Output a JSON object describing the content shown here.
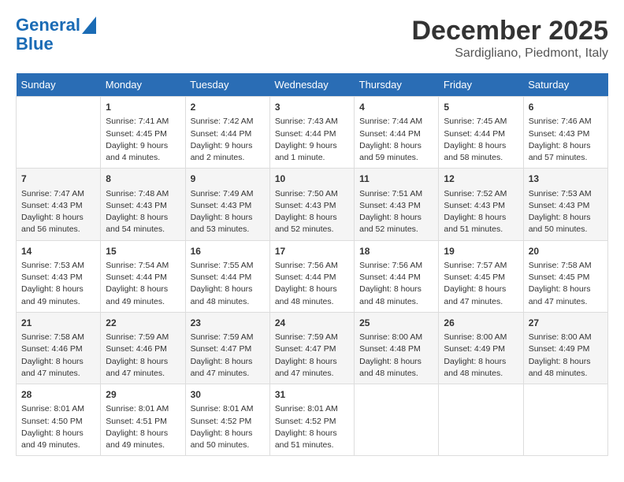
{
  "logo": {
    "line1": "General",
    "line2": "Blue"
  },
  "title": "December 2025",
  "location": "Sardigliano, Piedmont, Italy",
  "headers": [
    "Sunday",
    "Monday",
    "Tuesday",
    "Wednesday",
    "Thursday",
    "Friday",
    "Saturday"
  ],
  "weeks": [
    [
      {
        "day": "",
        "content": ""
      },
      {
        "day": "1",
        "content": "Sunrise: 7:41 AM\nSunset: 4:45 PM\nDaylight: 9 hours\nand 4 minutes."
      },
      {
        "day": "2",
        "content": "Sunrise: 7:42 AM\nSunset: 4:44 PM\nDaylight: 9 hours\nand 2 minutes."
      },
      {
        "day": "3",
        "content": "Sunrise: 7:43 AM\nSunset: 4:44 PM\nDaylight: 9 hours\nand 1 minute."
      },
      {
        "day": "4",
        "content": "Sunrise: 7:44 AM\nSunset: 4:44 PM\nDaylight: 8 hours\nand 59 minutes."
      },
      {
        "day": "5",
        "content": "Sunrise: 7:45 AM\nSunset: 4:44 PM\nDaylight: 8 hours\nand 58 minutes."
      },
      {
        "day": "6",
        "content": "Sunrise: 7:46 AM\nSunset: 4:43 PM\nDaylight: 8 hours\nand 57 minutes."
      }
    ],
    [
      {
        "day": "7",
        "content": "Sunrise: 7:47 AM\nSunset: 4:43 PM\nDaylight: 8 hours\nand 56 minutes."
      },
      {
        "day": "8",
        "content": "Sunrise: 7:48 AM\nSunset: 4:43 PM\nDaylight: 8 hours\nand 54 minutes."
      },
      {
        "day": "9",
        "content": "Sunrise: 7:49 AM\nSunset: 4:43 PM\nDaylight: 8 hours\nand 53 minutes."
      },
      {
        "day": "10",
        "content": "Sunrise: 7:50 AM\nSunset: 4:43 PM\nDaylight: 8 hours\nand 52 minutes."
      },
      {
        "day": "11",
        "content": "Sunrise: 7:51 AM\nSunset: 4:43 PM\nDaylight: 8 hours\nand 52 minutes."
      },
      {
        "day": "12",
        "content": "Sunrise: 7:52 AM\nSunset: 4:43 PM\nDaylight: 8 hours\nand 51 minutes."
      },
      {
        "day": "13",
        "content": "Sunrise: 7:53 AM\nSunset: 4:43 PM\nDaylight: 8 hours\nand 50 minutes."
      }
    ],
    [
      {
        "day": "14",
        "content": "Sunrise: 7:53 AM\nSunset: 4:43 PM\nDaylight: 8 hours\nand 49 minutes."
      },
      {
        "day": "15",
        "content": "Sunrise: 7:54 AM\nSunset: 4:44 PM\nDaylight: 8 hours\nand 49 minutes."
      },
      {
        "day": "16",
        "content": "Sunrise: 7:55 AM\nSunset: 4:44 PM\nDaylight: 8 hours\nand 48 minutes."
      },
      {
        "day": "17",
        "content": "Sunrise: 7:56 AM\nSunset: 4:44 PM\nDaylight: 8 hours\nand 48 minutes."
      },
      {
        "day": "18",
        "content": "Sunrise: 7:56 AM\nSunset: 4:44 PM\nDaylight: 8 hours\nand 48 minutes."
      },
      {
        "day": "19",
        "content": "Sunrise: 7:57 AM\nSunset: 4:45 PM\nDaylight: 8 hours\nand 47 minutes."
      },
      {
        "day": "20",
        "content": "Sunrise: 7:58 AM\nSunset: 4:45 PM\nDaylight: 8 hours\nand 47 minutes."
      }
    ],
    [
      {
        "day": "21",
        "content": "Sunrise: 7:58 AM\nSunset: 4:46 PM\nDaylight: 8 hours\nand 47 minutes."
      },
      {
        "day": "22",
        "content": "Sunrise: 7:59 AM\nSunset: 4:46 PM\nDaylight: 8 hours\nand 47 minutes."
      },
      {
        "day": "23",
        "content": "Sunrise: 7:59 AM\nSunset: 4:47 PM\nDaylight: 8 hours\nand 47 minutes."
      },
      {
        "day": "24",
        "content": "Sunrise: 7:59 AM\nSunset: 4:47 PM\nDaylight: 8 hours\nand 47 minutes."
      },
      {
        "day": "25",
        "content": "Sunrise: 8:00 AM\nSunset: 4:48 PM\nDaylight: 8 hours\nand 48 minutes."
      },
      {
        "day": "26",
        "content": "Sunrise: 8:00 AM\nSunset: 4:49 PM\nDaylight: 8 hours\nand 48 minutes."
      },
      {
        "day": "27",
        "content": "Sunrise: 8:00 AM\nSunset: 4:49 PM\nDaylight: 8 hours\nand 48 minutes."
      }
    ],
    [
      {
        "day": "28",
        "content": "Sunrise: 8:01 AM\nSunset: 4:50 PM\nDaylight: 8 hours\nand 49 minutes."
      },
      {
        "day": "29",
        "content": "Sunrise: 8:01 AM\nSunset: 4:51 PM\nDaylight: 8 hours\nand 49 minutes."
      },
      {
        "day": "30",
        "content": "Sunrise: 8:01 AM\nSunset: 4:52 PM\nDaylight: 8 hours\nand 50 minutes."
      },
      {
        "day": "31",
        "content": "Sunrise: 8:01 AM\nSunset: 4:52 PM\nDaylight: 8 hours\nand 51 minutes."
      },
      {
        "day": "",
        "content": ""
      },
      {
        "day": "",
        "content": ""
      },
      {
        "day": "",
        "content": ""
      }
    ]
  ]
}
